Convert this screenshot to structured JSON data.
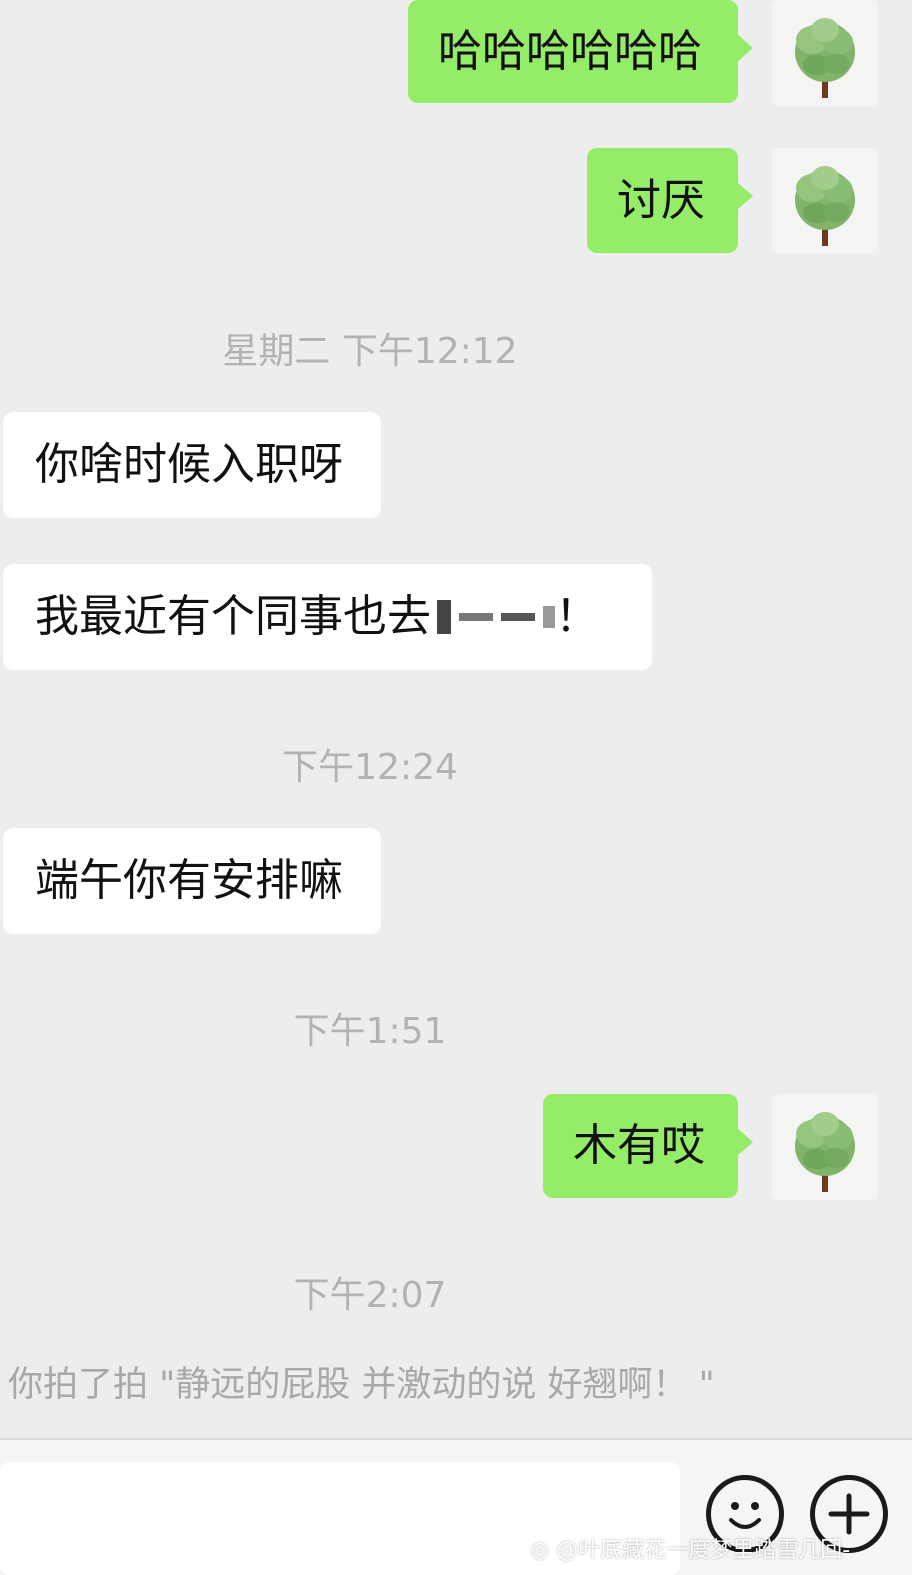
{
  "messages": [
    {
      "sender": "me",
      "text": "哈哈哈哈哈哈"
    },
    {
      "sender": "me",
      "text": "讨厌"
    },
    {
      "sender": "them",
      "text": "你啥时候入职呀"
    },
    {
      "sender": "them",
      "text": "我最近有个同事也去"
    },
    {
      "sender": "them",
      "text": "端午你有安排嘛"
    },
    {
      "sender": "me",
      "text": "木有哎"
    }
  ],
  "censored_tail": "！",
  "timestamps": [
    "星期二 下午12:12",
    "下午12:24",
    "下午1:51",
    "下午2:07"
  ],
  "system_note": "你拍了拍 \"静远的屁股 并激动的说 好翘啊！ \"",
  "icons": {
    "avatar": "tree-avatar-icon",
    "emoji": "smiley-face-icon",
    "more": "plus-icon",
    "watermark": "weibo-icon"
  },
  "colors": {
    "background": "#ededed",
    "my_bubble": "#95ec69",
    "their_bubble": "#ffffff",
    "timestamp": "#b2b2b2"
  },
  "watermark": "@叶底藏花一度梦里踏雪几回-"
}
